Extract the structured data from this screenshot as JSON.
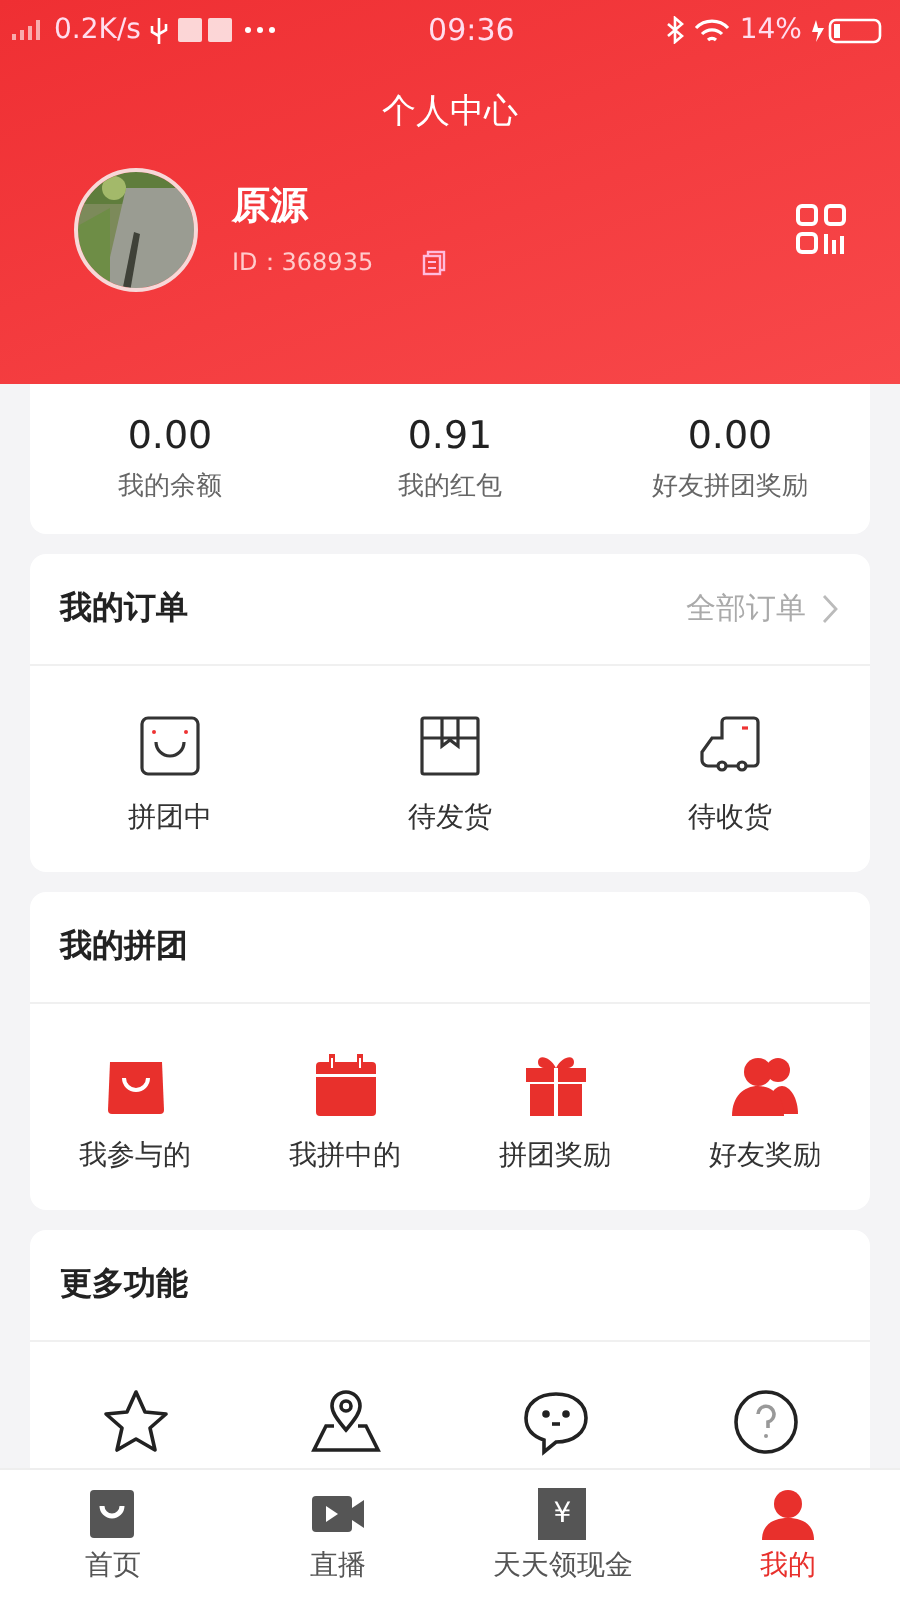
{
  "status_bar": {
    "speed": "0.2K/s",
    "time": "09:36",
    "battery": "14%"
  },
  "header": {
    "title": "个人中心"
  },
  "profile": {
    "name": "原源",
    "id": "ID：368935"
  },
  "stats": [
    {
      "value": "0.00",
      "label": "我的余额"
    },
    {
      "value": "0.91",
      "label": "我的红包"
    },
    {
      "value": "0.00",
      "label": "好友拼团奖励"
    }
  ],
  "orders": {
    "title": "我的订单",
    "link": "全部订单",
    "items": [
      {
        "label": "拼团中"
      },
      {
        "label": "待发货"
      },
      {
        "label": "待收货"
      }
    ]
  },
  "groups": {
    "title": "我的拼团",
    "items": [
      {
        "label": "我参与的"
      },
      {
        "label": "我拼中的"
      },
      {
        "label": "拼团奖励"
      },
      {
        "label": "好友奖励"
      }
    ]
  },
  "more": {
    "title": "更多功能"
  },
  "tab_bar": [
    {
      "label": "首页",
      "selected": false
    },
    {
      "label": "直播",
      "selected": false
    },
    {
      "glyph": "¥",
      "label": "天天领现金",
      "selected": false
    },
    {
      "label": "我的",
      "selected": true
    }
  ]
}
